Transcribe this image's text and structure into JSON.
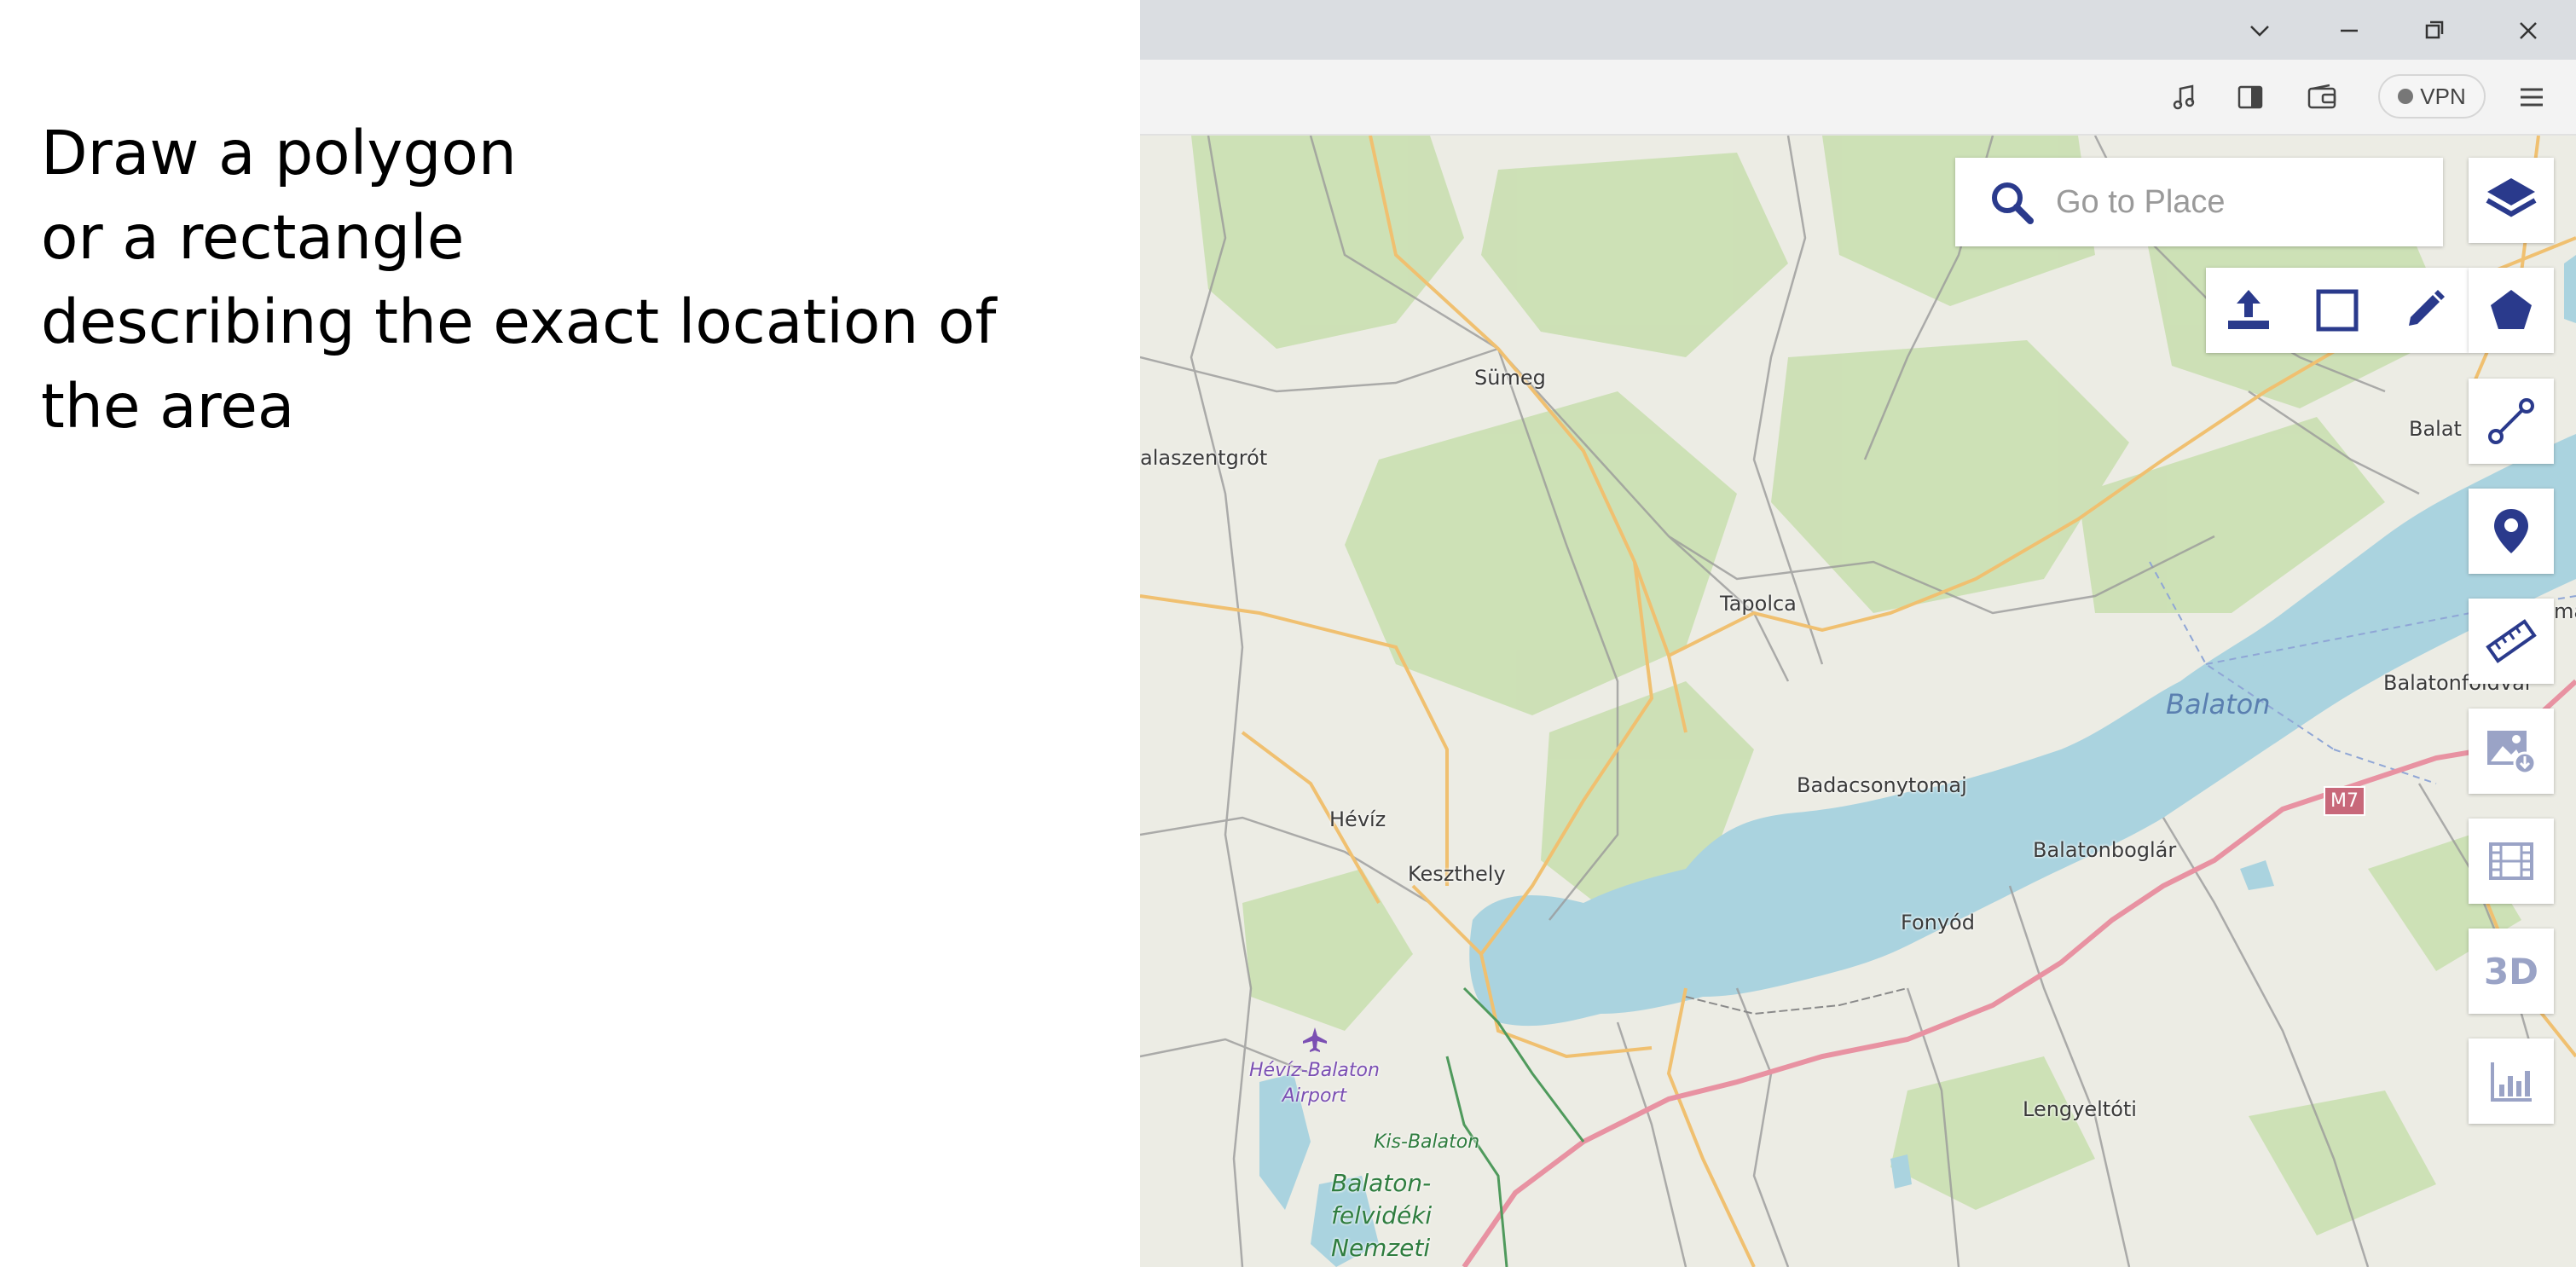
{
  "instructions": {
    "lines": [
      "Draw a polygon",
      "or a rectangle",
      "describing the exact location of",
      "the area"
    ]
  },
  "browser": {
    "vpn_label": "VPN"
  },
  "search": {
    "placeholder": "Go to Place"
  },
  "tools": {
    "three_d_label": "3D"
  },
  "map": {
    "places": {
      "sumeg": "Sümeg",
      "zalaszentgrot": "alaszentgrót",
      "tapolca": "Tapolca",
      "balaton_lake": "Balaton",
      "badacsonytomaj": "Badacsonytomaj",
      "heviz": "Hévíz",
      "keszthely": "Keszthely",
      "balatonboglar": "Balatonboglár",
      "fonyod": "Fonyód",
      "lengyeltoti": "Lengyeltóti",
      "balatonfoldvar": "Balatonföldvár",
      "balat_top": "Balat",
      "ma_edge": "má",
      "airport_line1": "Hévíz-Balaton",
      "airport_line2": "Airport",
      "kis_balaton": "Kis-Balaton",
      "park_line1": "Balaton-",
      "park_line2": "felvidéki",
      "park_line3": "Nemzeti",
      "m7": "M7"
    }
  },
  "colors": {
    "accent": "#2a3a8c",
    "water": "#aad3df",
    "motorway": "#e892a2",
    "forest": "#c8dfae"
  },
  "icons": [
    "chevron-down-icon",
    "minimize-icon",
    "restore-icon",
    "close-icon",
    "music-icon",
    "sidebar-icon",
    "wallet-icon",
    "menu-icon",
    "search-icon",
    "layers-icon",
    "upload-icon",
    "rectangle-icon",
    "pencil-icon",
    "polygon-icon",
    "line-icon",
    "marker-icon",
    "ruler-icon",
    "image-download-icon",
    "film-icon",
    "chart-icon"
  ]
}
